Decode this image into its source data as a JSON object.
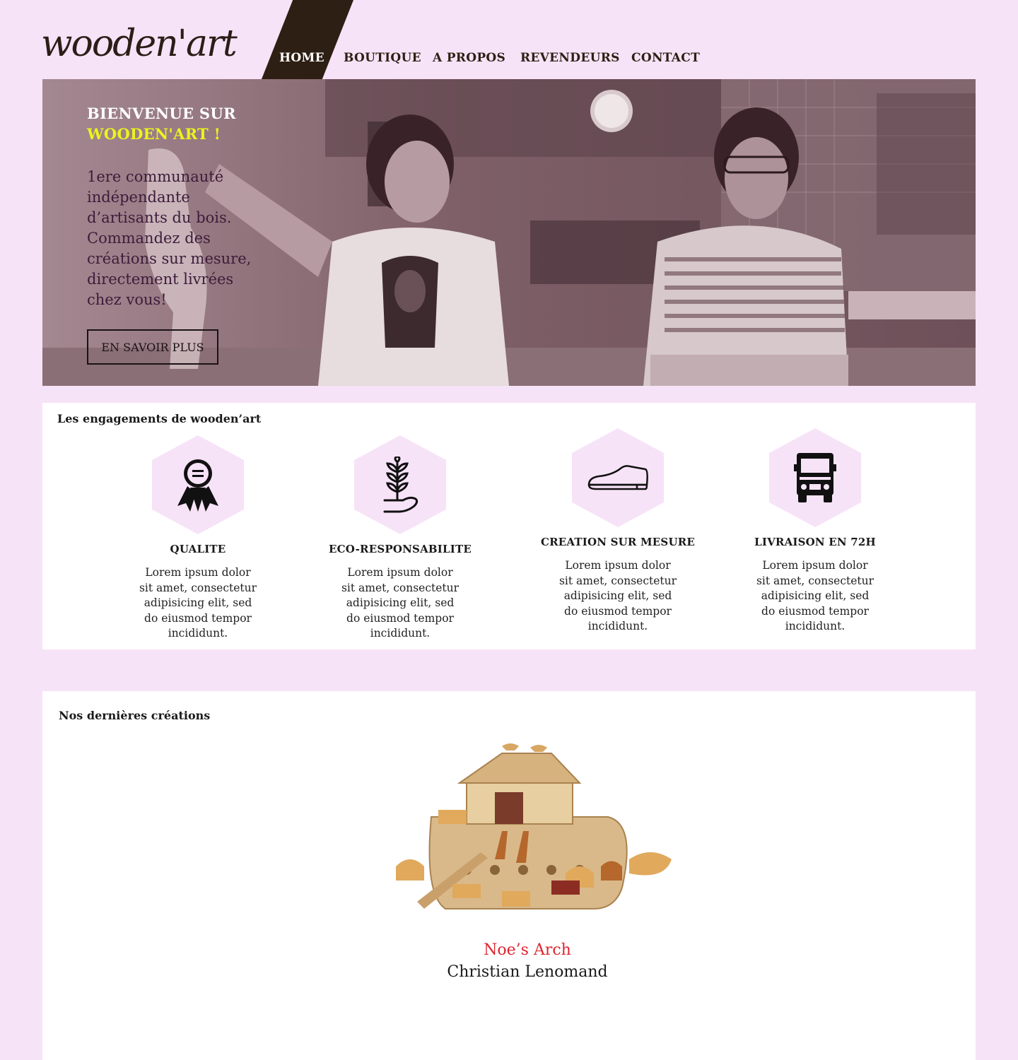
{
  "brand": {
    "logo": "wooden'art"
  },
  "nav": {
    "items": [
      {
        "label": "HOME",
        "active": true
      },
      {
        "label": "BOUTIQUE",
        "active": false
      },
      {
        "label": "A PROPOS",
        "active": false
      },
      {
        "label": "REVENDEURS",
        "active": false
      },
      {
        "label": "CONTACT",
        "active": false
      }
    ]
  },
  "hero": {
    "title_line1": "BIENVENUE SUR",
    "title_line2": "WOODEN'ART !",
    "text": "1ere communauté indépendante d’artisants du bois. Commandez des créations sur mesure, directement livrées chez vous!",
    "button": "EN SAVOIR PLUS"
  },
  "engagements": {
    "title": "Les engagements de wooden’art",
    "features": [
      {
        "icon": "award-ribbon-icon",
        "title": "QUALITE",
        "text": "Lorem ipsum dolor sit amet, consectetur adipisicing elit, sed do eiusmod tempor incididunt."
      },
      {
        "icon": "plant-in-hand-icon",
        "title": "ECO-RESPONSABILITE",
        "text": "Lorem ipsum dolor sit amet, consectetur adipisicing elit, sed do eiusmod tempor incididunt."
      },
      {
        "icon": "shoe-icon",
        "title": "CREATION SUR MESURE",
        "text": "Lorem ipsum dolor sit amet, consectetur adipisicing elit, sed do eiusmod tempor incididunt."
      },
      {
        "icon": "delivery-truck-icon",
        "title": "LIVRAISON EN 72H",
        "text": "Lorem ipsum dolor sit amet, consectetur adipisicing elit, sed do eiusmod tempor incididunt."
      }
    ]
  },
  "creations": {
    "title": "Nos dernières créations",
    "items": [
      {
        "name": "Noe’s Arch",
        "author": "Christian Lenomand"
      }
    ]
  },
  "colors": {
    "background": "#f7e3f7",
    "nav_dark": "#2e1f14",
    "hero_accent": "#e9f51c",
    "product_name": "#e0242e"
  }
}
